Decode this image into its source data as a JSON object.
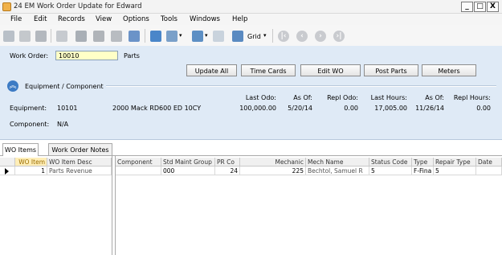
{
  "window": {
    "title": "24 EM Work Order Update for Edward",
    "min": "_",
    "max": "□",
    "close": "X"
  },
  "menu": [
    "File",
    "Edit",
    "Records",
    "View",
    "Options",
    "Tools",
    "Windows",
    "Help"
  ],
  "toolbar": {
    "grid_label": "Grid"
  },
  "header": {
    "work_order_label": "Work Order:",
    "work_order_value": "10010",
    "work_order_desc": "Parts",
    "buttons": [
      "Update All",
      "Time Cards",
      "Edit WO",
      "Post Parts",
      "Meters"
    ],
    "section_title": "Equipment / Component",
    "equipment_label": "Equipment:",
    "equipment_code": "10101",
    "equipment_desc": "2000 Mack RD600 ED 10CY",
    "component_label": "Component:",
    "component_value": "N/A",
    "meters": {
      "last_odo_label": "Last Odo:",
      "last_odo": "100,000.00",
      "as_of_label_1": "As Of:",
      "as_of_1": "5/20/14",
      "repl_odo_label": "Repl Odo:",
      "repl_odo": "0.00",
      "last_hours_label": "Last Hours:",
      "last_hours": "17,005.00",
      "as_of_label_2": "As Of:",
      "as_of_2": "11/26/14",
      "repl_hours_label": "Repl Hours:",
      "repl_hours": "0.00"
    }
  },
  "tabs": [
    "WO Items",
    "Work Order Notes"
  ],
  "left_grid": {
    "columns": [
      "WO Item",
      "WO Item Desc"
    ],
    "rows": [
      [
        "1",
        "Parts Revenue"
      ]
    ]
  },
  "right_grid": {
    "columns": [
      "Component",
      "Std Maint Group",
      "PR Co",
      "Mechanic",
      "Mech Name",
      "Status Code",
      "Type",
      "Repair Type",
      "Date"
    ],
    "rows": [
      [
        "",
        "000",
        "24",
        "225",
        "Bechtol, Samuel R",
        "5",
        "F-Fina",
        "5",
        ""
      ]
    ]
  }
}
